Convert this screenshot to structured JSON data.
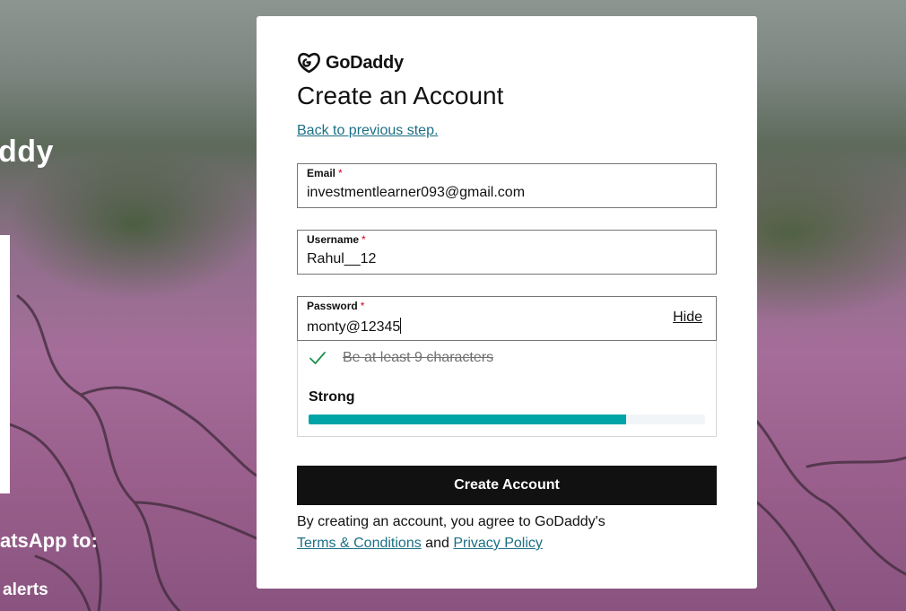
{
  "background": {
    "brand_text": "ddy",
    "promo_line1": "atsApp to:",
    "promo_line2": "alerts"
  },
  "logo": {
    "icon": "godaddy-logo-icon",
    "text": "GoDaddy"
  },
  "page": {
    "title": "Create an Account",
    "back_link": "Back to previous step."
  },
  "form": {
    "email": {
      "label": "Email",
      "required_mark": "*",
      "value": "investmentlearner093@gmail.com"
    },
    "username": {
      "label": "Username",
      "required_mark": "*",
      "value": "Rahul__12"
    },
    "password": {
      "label": "Password",
      "required_mark": "*",
      "value": "monty@12345",
      "toggle_label": "Hide"
    },
    "password_rules": [
      {
        "text": "Be at least 9 characters",
        "met": true,
        "icon": "checkmark-icon"
      }
    ],
    "strength": {
      "label": "Strong",
      "level": 0.8,
      "color": "#00a4a6"
    },
    "submit_label": "Create Account"
  },
  "legal": {
    "prefix": "By creating an account, you agree to GoDaddy's",
    "terms_link": "Terms & Conditions",
    "conjunction": "and",
    "privacy_link": "Privacy Policy"
  },
  "colors": {
    "link": "#1b6f85",
    "primary_button": "#111111",
    "required": "#d0021b",
    "meter_fill": "#00a4a6"
  }
}
